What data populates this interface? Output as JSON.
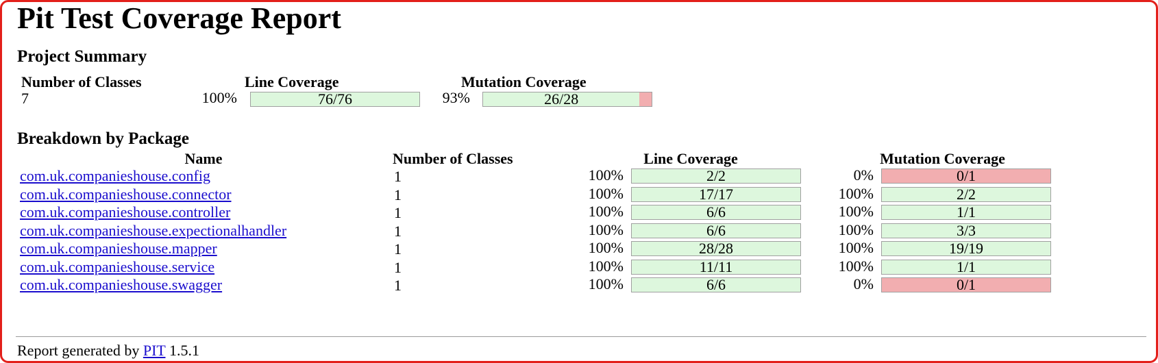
{
  "title": "Pit Test Coverage Report",
  "project_summary": {
    "heading": "Project Summary",
    "headers": {
      "classes": "Number of Classes",
      "line": "Line Coverage",
      "mutation": "Mutation Coverage"
    },
    "classes": "7",
    "line_pct": "100%",
    "line_text": "76/76",
    "line_fraction": 1.0,
    "mutation_pct": "93%",
    "mutation_text": "26/28",
    "mutation_fraction": 0.9286
  },
  "breakdown": {
    "heading": "Breakdown by Package",
    "headers": {
      "name": "Name",
      "classes": "Number of Classes",
      "line": "Line Coverage",
      "mutation": "Mutation Coverage"
    },
    "rows": [
      {
        "name": "com.uk.companieshouse.config",
        "classes": "1",
        "line_pct": "100%",
        "line_text": "2/2",
        "line_fraction": 1.0,
        "mutation_pct": "0%",
        "mutation_text": "0/1",
        "mutation_fraction": 0.0
      },
      {
        "name": "com.uk.companieshouse.connector",
        "classes": "1",
        "line_pct": "100%",
        "line_text": "17/17",
        "line_fraction": 1.0,
        "mutation_pct": "100%",
        "mutation_text": "2/2",
        "mutation_fraction": 1.0
      },
      {
        "name": "com.uk.companieshouse.controller",
        "classes": "1",
        "line_pct": "100%",
        "line_text": "6/6",
        "line_fraction": 1.0,
        "mutation_pct": "100%",
        "mutation_text": "1/1",
        "mutation_fraction": 1.0
      },
      {
        "name": "com.uk.companieshouse.expectionalhandler",
        "classes": "1",
        "line_pct": "100%",
        "line_text": "6/6",
        "line_fraction": 1.0,
        "mutation_pct": "100%",
        "mutation_text": "3/3",
        "mutation_fraction": 1.0
      },
      {
        "name": "com.uk.companieshouse.mapper",
        "classes": "1",
        "line_pct": "100%",
        "line_text": "28/28",
        "line_fraction": 1.0,
        "mutation_pct": "100%",
        "mutation_text": "19/19",
        "mutation_fraction": 1.0
      },
      {
        "name": "com.uk.companieshouse.service",
        "classes": "1",
        "line_pct": "100%",
        "line_text": "11/11",
        "line_fraction": 1.0,
        "mutation_pct": "100%",
        "mutation_text": "1/1",
        "mutation_fraction": 1.0
      },
      {
        "name": "com.uk.companieshouse.swagger",
        "classes": "1",
        "line_pct": "100%",
        "line_text": "6/6",
        "line_fraction": 1.0,
        "mutation_pct": "0%",
        "mutation_text": "0/1",
        "mutation_fraction": 0.0
      }
    ]
  },
  "footer": {
    "prefix": "Report generated by",
    "link": "PIT",
    "version": "1.5.1"
  },
  "colors": {
    "covered": "#ddf7dd",
    "uncovered": "#f2aeb0",
    "link": "#1a0dcd",
    "frame": "#e3201b"
  }
}
